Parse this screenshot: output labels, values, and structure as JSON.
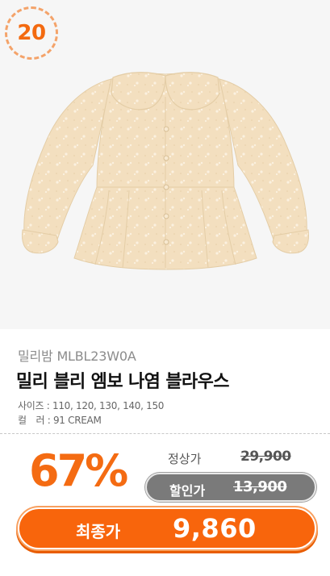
{
  "product": {
    "rank": "20",
    "brand": "밀리밤 MLBL23W0A",
    "name": "밀리 블리 엠보 나염 블라우스",
    "size_line": "사이즈 : 110, 120, 130, 140, 150",
    "color_line": "컬　러 : 91 CREAM",
    "image_alt": "cream floral blouse with peter pan collar"
  },
  "pricing": {
    "discount": "67%",
    "regular_label": "정상가",
    "regular_price": "29,900",
    "sale_label": "할인가",
    "sale_price": "13,900",
    "final_label": "최종가",
    "final_price": "9,860"
  },
  "colors": {
    "accent": "#f8650c",
    "discount_text": "#f46b12",
    "sale_pill": "#7a7a7a",
    "garment": "#f3dfbf"
  }
}
